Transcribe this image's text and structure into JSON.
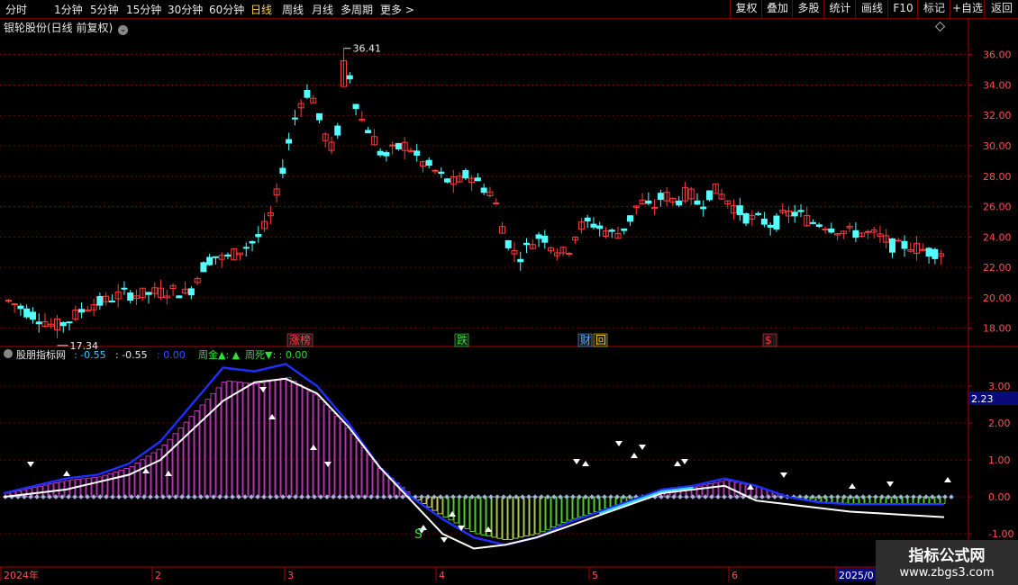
{
  "toolbar": {
    "timeframes": [
      {
        "label": "分时",
        "active": false
      },
      {
        "label": "1分钟",
        "active": false
      },
      {
        "label": "5分钟",
        "active": false
      },
      {
        "label": "15分钟",
        "active": false
      },
      {
        "label": "30分钟",
        "active": false
      },
      {
        "label": "60分钟",
        "active": false
      },
      {
        "label": "日线",
        "active": true
      },
      {
        "label": "周线",
        "active": false
      },
      {
        "label": "月线",
        "active": false
      },
      {
        "label": "多周期",
        "active": false
      },
      {
        "label": "更多 >",
        "active": false
      }
    ],
    "right_buttons": [
      "复权",
      "叠加",
      "多股",
      "统计",
      "画线",
      "F10",
      "标记",
      "+自选",
      "返回"
    ]
  },
  "header": {
    "stock_title": "银轮股份(日线 前复权)"
  },
  "colors": {
    "up": "#ff3b3b",
    "down": "#54ffff",
    "axis": "#b00000",
    "grid": "#8a0000",
    "blue_line": "#1f2fff",
    "white_line": "#ffffff",
    "cyan_line": "#30d8ff",
    "magenta": "#e040e0",
    "green_hist": "#66ff33",
    "yellow_hist": "#ffff55"
  },
  "main_chart": {
    "y_ticks": [
      "36.00",
      "34.00",
      "32.00",
      "30.00",
      "28.00",
      "26.00",
      "24.00",
      "22.00",
      "20.00",
      "18.00"
    ],
    "y_range": [
      16.8,
      37.4
    ],
    "high_label": "36.41",
    "low_label": "17.34",
    "event_markers": [
      {
        "text": "涨榜",
        "color": "#ff4040"
      },
      {
        "text": "跌",
        "color": "#33dd33"
      },
      {
        "text": "财",
        "color": "#55aaff"
      },
      {
        "text": "回",
        "color": "#ffcc00"
      },
      {
        "text": "$",
        "color": "#ff3030"
      }
    ]
  },
  "indicator": {
    "name": "股朋指标网",
    "values": [
      {
        "text": ": -0.55",
        "color": "#40c8ff"
      },
      {
        "text": ": -0.55",
        "color": "#e8e8e8"
      },
      {
        "text": ": 0.00",
        "color": "#3355ff"
      },
      {
        "text": "周金▲: ▲",
        "color": "#33dd33"
      },
      {
        "text": "周死▼: : 0.00",
        "color": "#33dd33"
      }
    ],
    "y_ticks": [
      "3.00",
      "2.00",
      "1.00",
      "0.00",
      "-1.00"
    ],
    "y_range": [
      -1.9,
      4.0
    ],
    "current_value_badge": "2.23",
    "s_marker": "S"
  },
  "x_axis": {
    "labels": [
      "2024年",
      "2",
      "3",
      "4",
      "5",
      "6",
      "2025/0"
    ]
  },
  "watermark": {
    "line1": "指标公式网",
    "line2": "www.zbgs3.com"
  },
  "chart_data": {
    "type": "candlestick",
    "title": "银轮股份(日线 前复权)",
    "y_range": [
      16.8,
      37.4
    ],
    "highest": 36.41,
    "lowest": 17.34,
    "close_path": [
      19.9,
      19.5,
      19.0,
      18.6,
      18.1,
      18.4,
      19.0,
      19.6,
      19.7,
      20.1,
      20.3,
      20.2,
      20.3,
      20.4,
      20.5,
      20.2,
      21.8,
      22.8,
      22.5,
      23.0,
      23.5,
      24.2,
      25.8,
      29.5,
      32.6,
      33.8,
      31.0,
      29.5,
      35.5,
      32.0,
      30.8,
      29.2,
      29.8,
      30.1,
      29.0,
      28.5,
      27.8,
      27.5,
      28.2,
      27.4,
      26.8,
      24.0,
      22.6,
      23.5,
      24.2,
      23.3,
      22.8,
      24.6,
      25.0,
      24.5,
      24.1,
      24.8,
      26.4,
      25.8,
      26.8,
      26.3,
      27.0,
      26.0,
      27.2,
      26.6,
      25.8,
      25.2,
      25.1,
      24.8,
      25.5,
      25.6,
      25.0,
      24.9,
      24.6,
      24.3,
      24.3,
      24.2,
      23.9,
      23.3,
      23.5,
      23.2,
      23.0,
      23.1
    ],
    "indicator_series": [
      {
        "name": "",
        "color": "#1f2fff",
        "values": [
          0.1,
          0.3,
          0.5,
          0.6,
          0.9,
          1.5,
          2.5,
          3.5,
          3.4,
          3.6,
          3.0,
          2.0,
          0.8,
          0.0,
          -0.6,
          -1.1,
          -1.3,
          -1.1,
          -0.7,
          -0.4,
          -0.1,
          0.2,
          0.3,
          0.5,
          0.3,
          0.0,
          -0.15,
          -0.2,
          -0.2,
          -0.2,
          -0.2
        ]
      },
      {
        "name": "",
        "color": "#ffffff",
        "values": [
          0.0,
          0.1,
          0.2,
          0.4,
          0.6,
          1.0,
          1.8,
          2.6,
          3.1,
          3.2,
          2.8,
          1.9,
          0.8,
          -0.1,
          -1.0,
          -1.4,
          -1.3,
          -1.1,
          -0.8,
          -0.5,
          -0.2,
          0.1,
          0.2,
          0.3,
          -0.1,
          -0.2,
          -0.3,
          -0.4,
          -0.45,
          -0.5,
          -0.55
        ]
      }
    ]
  }
}
